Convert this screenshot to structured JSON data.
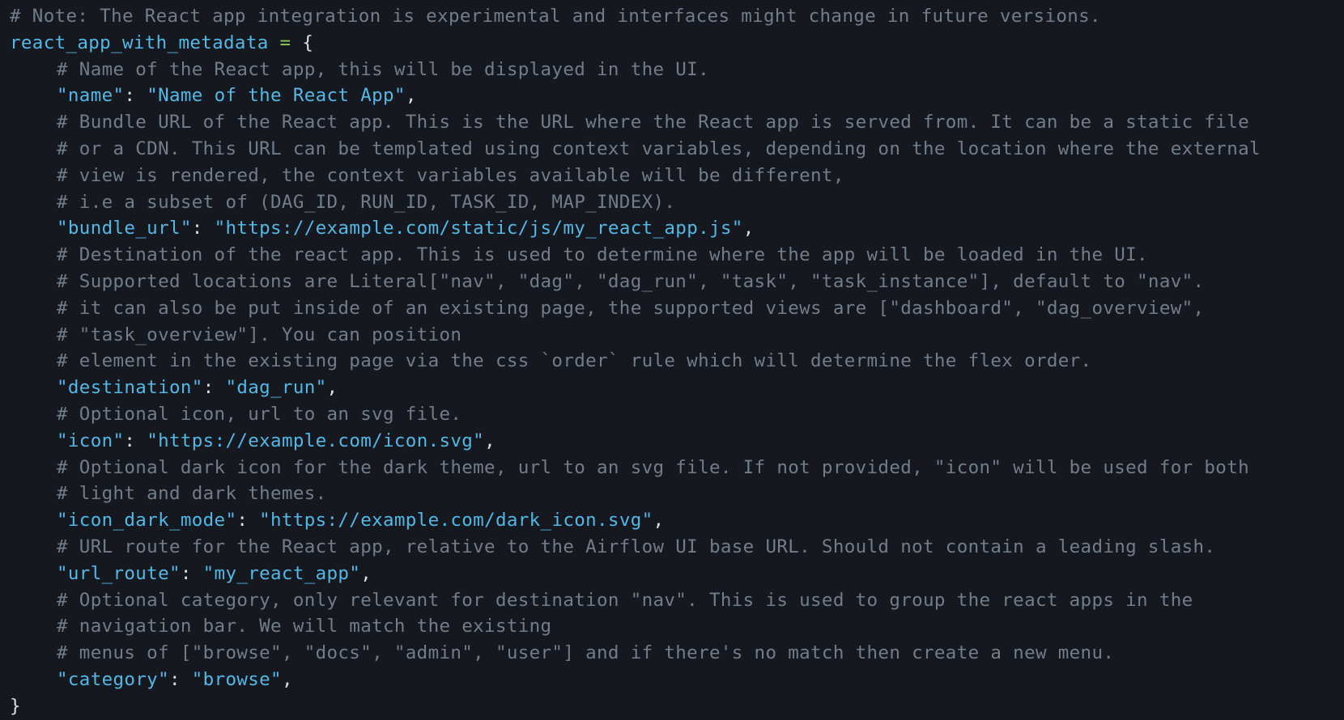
{
  "editor": {
    "theme_colors": {
      "background": "#15181e",
      "comment": "#727d8a",
      "string": "#52b8e6",
      "identifier": "#52b8e6",
      "operator": "#8acb53",
      "punctuation": "#d9dee5"
    },
    "lines": [
      {
        "comment": "# Note: The React app integration is experimental and interfaces might change in future versions."
      },
      {
        "ident": "react_app_with_metadata",
        "op": " = ",
        "punct": "{"
      },
      {
        "comment": "# Name of the React app, this will be displayed in the UI."
      },
      {
        "key": "\"name\"",
        "sep": ": ",
        "value": "\"Name of the React App\"",
        "end": ","
      },
      {
        "comment": "# Bundle URL of the React app. This is the URL where the React app is served from. It can be a static file"
      },
      {
        "comment": "# or a CDN. This URL can be templated using context variables, depending on the location where the external"
      },
      {
        "comment": "# view is rendered, the context variables available will be different,"
      },
      {
        "comment": "# i.e a subset of (DAG_ID, RUN_ID, TASK_ID, MAP_INDEX)."
      },
      {
        "key": "\"bundle_url\"",
        "sep": ": ",
        "value": "\"https://example.com/static/js/my_react_app.js\"",
        "end": ","
      },
      {
        "comment": "# Destination of the react app. This is used to determine where the app will be loaded in the UI."
      },
      {
        "comment": "# Supported locations are Literal[\"nav\", \"dag\", \"dag_run\", \"task\", \"task_instance\"], default to \"nav\"."
      },
      {
        "comment": "# it can also be put inside of an existing page, the supported views are [\"dashboard\", \"dag_overview\","
      },
      {
        "comment": "# \"task_overview\"]. You can position"
      },
      {
        "comment": "# element in the existing page via the css `order` rule which will determine the flex order."
      },
      {
        "key": "\"destination\"",
        "sep": ": ",
        "value": "\"dag_run\"",
        "end": ","
      },
      {
        "comment": "# Optional icon, url to an svg file."
      },
      {
        "key": "\"icon\"",
        "sep": ": ",
        "value": "\"https://example.com/icon.svg\"",
        "end": ","
      },
      {
        "comment": "# Optional dark icon for the dark theme, url to an svg file. If not provided, \"icon\" will be used for both"
      },
      {
        "comment": "# light and dark themes."
      },
      {
        "key": "\"icon_dark_mode\"",
        "sep": ": ",
        "value": "\"https://example.com/dark_icon.svg\"",
        "end": ","
      },
      {
        "comment": "# URL route for the React app, relative to the Airflow UI base URL. Should not contain a leading slash."
      },
      {
        "key": "\"url_route\"",
        "sep": ": ",
        "value": "\"my_react_app\"",
        "end": ","
      },
      {
        "comment": "# Optional category, only relevant for destination \"nav\". This is used to group the react apps in the"
      },
      {
        "comment": "# navigation bar. We will match the existing"
      },
      {
        "comment": "# menus of [\"browse\", \"docs\", \"admin\", \"user\"] and if there's no match then create a new menu."
      },
      {
        "key": "\"category\"",
        "sep": ": ",
        "value": "\"browse\"",
        "end": ","
      },
      {
        "punct": "}"
      }
    ]
  }
}
